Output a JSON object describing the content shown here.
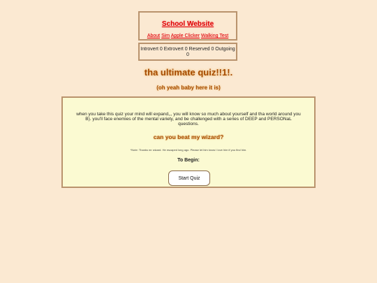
{
  "header": {
    "title": "School Website",
    "nav": [
      {
        "label": "About"
      },
      {
        "label": "Sim"
      },
      {
        "label": "Apple Clicker"
      },
      {
        "label": "Walking Test"
      }
    ]
  },
  "scores": {
    "text": "Introvert 0 Extrovert 0 Reserved 0 Outgoing 0"
  },
  "page": {
    "title": "tha ultimate quiz!!1!.",
    "subtitle": "(oh yeah baby here it is)"
  },
  "quiz": {
    "intro": "when you take this quiz your mind will expand,,, you will know so much about yourself and tha world around you B). you'll face enemies of the mental variety, and be challenged with a series of DEEP and PERSONaL questions.",
    "challenge": "can you beat my wizard?",
    "note": "*Note: Thanks mr wizard. He escaped long ago. Please let him know I love him if you find him.",
    "to_begin": "To Begin:",
    "start_label": "Start Quiz"
  },
  "colors": {
    "background": "#fbe9d2",
    "quiz_box": "#fbfad2",
    "link": "#e00000",
    "heading": "#a64b00",
    "border": "#b9936d"
  }
}
